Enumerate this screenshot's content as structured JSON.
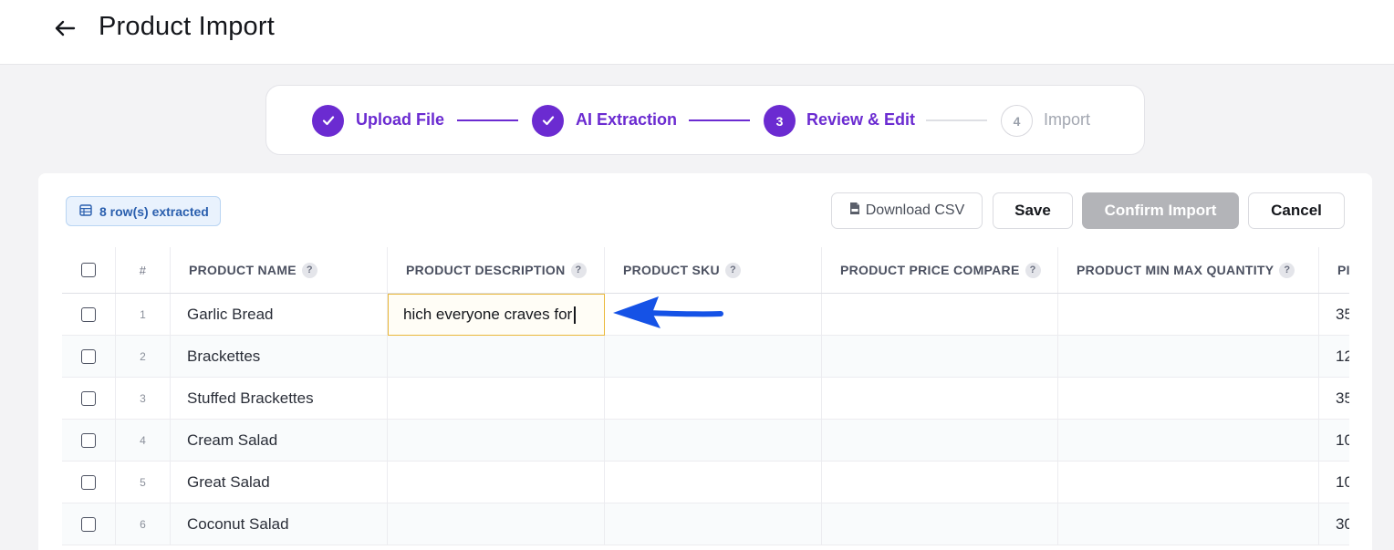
{
  "header": {
    "title": "Product Import",
    "back_icon": "arrow-left-icon"
  },
  "stepper": {
    "steps": [
      {
        "label": "Upload File",
        "marker": "",
        "state": "done"
      },
      {
        "label": "AI Extraction",
        "marker": "",
        "state": "done"
      },
      {
        "label": "Review & Edit",
        "marker": "3",
        "state": "active"
      },
      {
        "label": "Import",
        "marker": "4",
        "state": "pending"
      }
    ],
    "accent": "#6b2bd1"
  },
  "toolbar": {
    "rows_badge": "8 row(s) extracted",
    "download_label": "Download CSV",
    "save_label": "Save",
    "confirm_label": "Confirm Import",
    "cancel_label": "Cancel"
  },
  "table": {
    "columns": [
      {
        "label": "#"
      },
      {
        "label": "PRODUCT NAME",
        "help": "?"
      },
      {
        "label": "PRODUCT DESCRIPTION",
        "help": "?"
      },
      {
        "label": "PRODUCT SKU",
        "help": "?"
      },
      {
        "label": "PRODUCT PRICE COMPARE",
        "help": "?"
      },
      {
        "label": "PRODUCT MIN MAX QUANTITY",
        "help": "?"
      },
      {
        "label": "PI"
      }
    ],
    "rows": [
      {
        "num": "1",
        "name": "Garlic Bread",
        "description": "hich everyone craves for",
        "sku": "",
        "price_compare": "",
        "min_max": "",
        "price": "35"
      },
      {
        "num": "2",
        "name": "Brackettes",
        "description": "",
        "sku": "",
        "price_compare": "",
        "min_max": "",
        "price": "12"
      },
      {
        "num": "3",
        "name": "Stuffed Brackettes",
        "description": "",
        "sku": "",
        "price_compare": "",
        "min_max": "",
        "price": "35"
      },
      {
        "num": "4",
        "name": "Cream Salad",
        "description": "",
        "sku": "",
        "price_compare": "",
        "min_max": "",
        "price": "10"
      },
      {
        "num": "5",
        "name": "Great Salad",
        "description": "",
        "sku": "",
        "price_compare": "",
        "min_max": "",
        "price": "10"
      },
      {
        "num": "6",
        "name": "Coconut Salad",
        "description": "",
        "sku": "",
        "price_compare": "",
        "min_max": "",
        "price": "30"
      }
    ],
    "editing": {
      "row": "1",
      "column": "PRODUCT DESCRIPTION",
      "border_color": "#eab83a"
    }
  },
  "annotation": {
    "icon": "arrow-left-annotation-icon",
    "color": "#1552e6"
  }
}
